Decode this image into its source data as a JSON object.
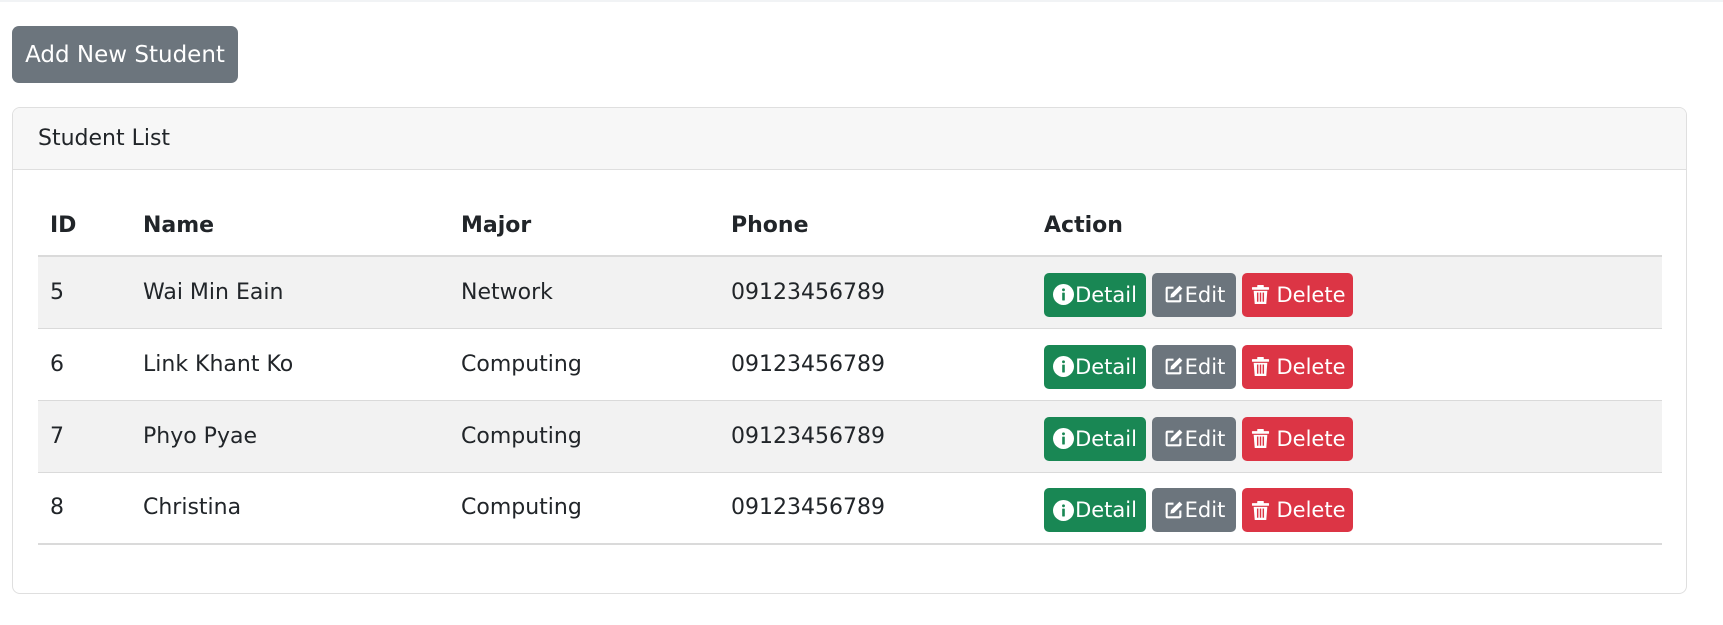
{
  "toolbar": {
    "add_label": "Add New Student"
  },
  "card": {
    "title": "Student List"
  },
  "table": {
    "headers": {
      "id": "ID",
      "name": "Name",
      "major": "Major",
      "phone": "Phone",
      "action": "Action"
    },
    "rows": [
      {
        "id": "5",
        "name": "Wai Min Eain",
        "major": "Network",
        "phone": "09123456789"
      },
      {
        "id": "6",
        "name": "Link Khant Ko",
        "major": "Computing",
        "phone": "09123456789"
      },
      {
        "id": "7",
        "name": "Phyo Pyae",
        "major": "Computing",
        "phone": "09123456789"
      },
      {
        "id": "8",
        "name": "Christina",
        "major": "Computing",
        "phone": "09123456789"
      }
    ],
    "actions": {
      "detail": "Detail",
      "edit": "Edit",
      "delete": "Delete"
    }
  },
  "icons": {
    "detail": "info-circle-icon",
    "edit": "pencil-square-icon",
    "delete": "trash-icon"
  },
  "colors": {
    "detail": "#198754",
    "edit": "#6c757d",
    "delete": "#dc3545",
    "add": "#6c757d"
  }
}
